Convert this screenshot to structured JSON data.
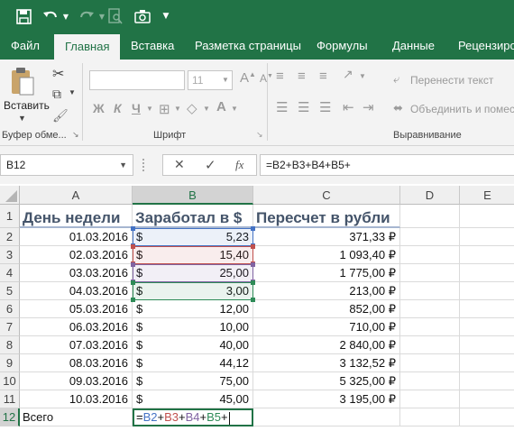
{
  "colors": {
    "accent": "#217346",
    "ref_b2": "#4472c4",
    "ref_b3": "#c0504d",
    "ref_b4": "#8064a2",
    "ref_b5": "#2e8b57"
  },
  "qat": {
    "icons": [
      "save-icon",
      "undo-icon",
      "redo-icon",
      "print-preview-icon",
      "camera-icon",
      "chevron-down-icon"
    ]
  },
  "tabs": [
    "Файл",
    "Главная",
    "Вставка",
    "Разметка страницы",
    "Формулы",
    "Данные",
    "Рецензиров"
  ],
  "ribbon": {
    "paste_label": "Вставить",
    "clipboard_label": "Буфер обме...",
    "font_label": "Шрифт",
    "font_size": "11",
    "bold": "Ж",
    "italic": "К",
    "underline": "Ч",
    "align_label": "Выравнивание",
    "wrap_text": "Перенести текст",
    "merge_center": "Объединить и помес"
  },
  "formula_bar": {
    "name_box": "B12",
    "cancel_symbol": "✕",
    "enter_symbol": "✓",
    "fx_symbol": "fx",
    "formula": "=B2+B3+B4+B5+"
  },
  "grid": {
    "columns": [
      "A",
      "B",
      "C",
      "D",
      "E"
    ],
    "rows": [
      "1",
      "2",
      "3",
      "4",
      "5",
      "6",
      "7",
      "8",
      "9",
      "10",
      "11",
      "12"
    ],
    "headers": {
      "a": "День недели",
      "b": "Заработал в $",
      "c": "Пересчет в рубли"
    },
    "currency": "$",
    "data": [
      {
        "date": "01.03.2016",
        "usd": "5,23",
        "rub": "371,33 ₽"
      },
      {
        "date": "02.03.2016",
        "usd": "15,40",
        "rub": "1 093,40 ₽"
      },
      {
        "date": "03.03.2016",
        "usd": "25,00",
        "rub": "1 775,00 ₽"
      },
      {
        "date": "04.03.2016",
        "usd": "3,00",
        "rub": "213,00 ₽"
      },
      {
        "date": "05.03.2016",
        "usd": "12,00",
        "rub": "852,00 ₽"
      },
      {
        "date": "06.03.2016",
        "usd": "10,00",
        "rub": "710,00 ₽"
      },
      {
        "date": "07.03.2016",
        "usd": "40,00",
        "rub": "2 840,00 ₽"
      },
      {
        "date": "08.03.2016",
        "usd": "44,12",
        "rub": "3 132,52 ₽"
      },
      {
        "date": "09.03.2016",
        "usd": "75,00",
        "rub": "5 325,00 ₽"
      },
      {
        "date": "10.03.2016",
        "usd": "45,00",
        "rub": "3 195,00 ₽"
      }
    ],
    "total_label": "Всего",
    "edit_formula": {
      "eq": "=",
      "r1": "B2",
      "p1": "+",
      "r2": "B3",
      "p2": "+",
      "r3": "B4",
      "p3": "+",
      "r4": "B5",
      "p4": "+"
    }
  }
}
